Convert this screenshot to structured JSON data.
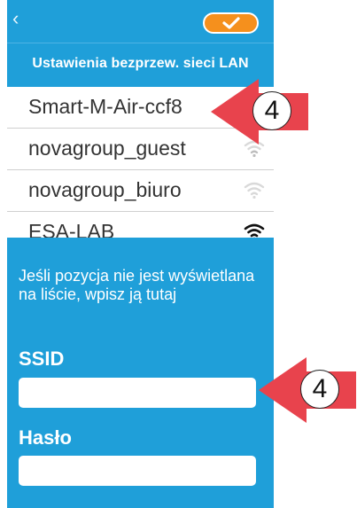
{
  "topbar": {
    "back_icon": "chevron-left-icon",
    "confirm_icon": "check-icon"
  },
  "screen": {
    "title": "Ustawienia bezprzew. sieci LAN"
  },
  "networks": [
    {
      "name": "Smart-M-Air-ccf8",
      "signal_icon": "none"
    },
    {
      "name": "novagroup_guest",
      "signal_icon": "wifi-weak-icon"
    },
    {
      "name": "novagroup_biuro",
      "signal_icon": "wifi-weak-icon"
    },
    {
      "name": "ESA-LAB",
      "signal_icon": "wifi-strong-icon"
    }
  ],
  "manual": {
    "hint": "Jeśli pozycja nie jest wyświetlana na liście, wpisz ją tutaj",
    "ssid_label": "SSID",
    "ssid_value": "",
    "password_label": "Hasło",
    "password_value": ""
  },
  "callouts": [
    {
      "number": "4"
    },
    {
      "number": "4"
    }
  ],
  "colors": {
    "accent": "#1f9fd9",
    "confirm": "#f5901d",
    "callout": "#e8434d"
  }
}
